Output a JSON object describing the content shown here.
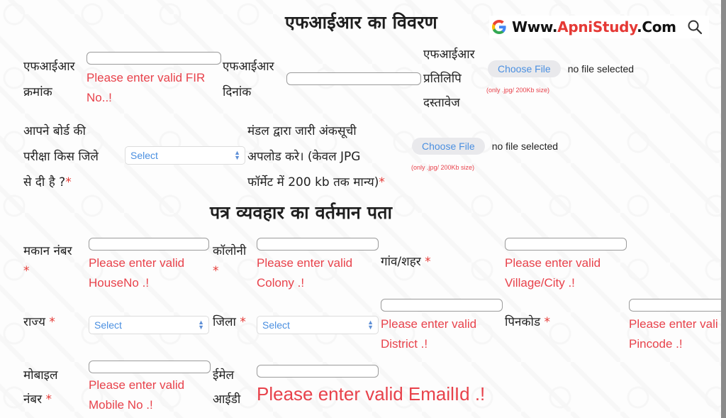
{
  "watermark": {
    "prefix": "Www.",
    "brand": "ApniStudy",
    "suffix": ".Com",
    "icons": [
      "google-g-icon",
      "search-icon"
    ]
  },
  "colors": {
    "error": "#e8424b",
    "required": "#e53935",
    "select_text": "#4a8fe0",
    "brand": "#e53935"
  },
  "fir_section": {
    "title": "एफआईआर का विवरण",
    "fir_number": {
      "label_line1": "एफआईआर",
      "label_line2": "क्रमांक",
      "value": "",
      "error_line1": "Please enter valid FIR",
      "error_line2": "No..!"
    },
    "fir_date": {
      "label_line1": "एफआईआर",
      "label_line2": "दिनांक",
      "value": ""
    },
    "fir_copy": {
      "label_line1": "एफआईआर",
      "label_line2": "प्रतिलिपि",
      "label_line3": "दस्तावेज",
      "button": "Choose File",
      "status": "no file selected",
      "hint": "(only .jpg/ 200Kb size)"
    },
    "exam_district": {
      "label_line1": "आपने बोर्ड की",
      "label_line2": "परीक्षा किस जिले",
      "label_line3": "से दी है ?",
      "required": "*",
      "selected": "Select"
    },
    "marksheet_upload": {
      "label_line1": "मंडल द्वारा जारी अंकसूची",
      "label_line2": "अपलोड करे। (केवल JPG",
      "label_line3": "फॉर्मेट में 200 kb तक मान्य)",
      "required": "*",
      "button": "Choose File",
      "status": "no file selected",
      "hint": "(only .jpg/ 200Kb size)"
    }
  },
  "address_section": {
    "title": "पत्र व्यवहार का वर्तमान पता",
    "house_no": {
      "label": "मकान नंबर",
      "required": "*",
      "value": "",
      "error_line1": "Please enter valid",
      "error_line2": "HouseNo .!"
    },
    "colony": {
      "label": "कॉलोनी",
      "required": "*",
      "value": "",
      "error_line1": "Please enter valid",
      "error_line2": "Colony .!"
    },
    "village_city": {
      "label": "गांव/शहर",
      "required": "*",
      "value": "",
      "error_line1": "Please enter valid",
      "error_line2": "Village/City .!"
    },
    "state": {
      "label": "राज्य",
      "required": "*",
      "selected": "Select"
    },
    "district": {
      "label": "जिला",
      "required": "*",
      "selected": "Select",
      "value": "",
      "error_line1": "Please enter valid",
      "error_line2": "District .!"
    },
    "pincode": {
      "label": "पिनकोड",
      "required": "*",
      "value": "",
      "error_line1": "Please enter vali",
      "error_line2": "Pincode .!"
    },
    "mobile": {
      "label_line1": "मोबाइल",
      "label_line2": "नंबर",
      "required": "*",
      "value": "",
      "error_line1": "Please enter valid",
      "error_line2": "Mobile No .!"
    },
    "email": {
      "label_line1": "ईमेल",
      "label_line2": "आईडी",
      "value": "",
      "error": "Please enter valid EmailId .!"
    }
  }
}
